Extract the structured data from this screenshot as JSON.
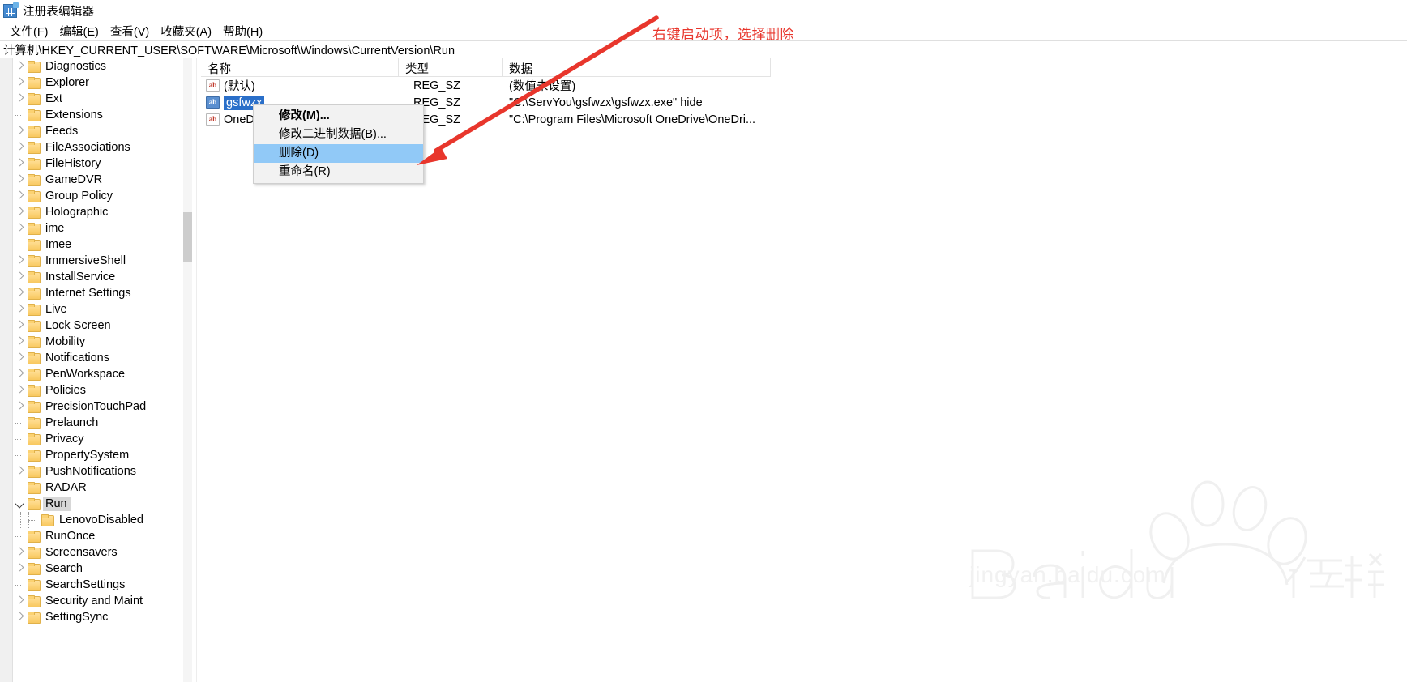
{
  "window": {
    "title": "注册表编辑器",
    "icon": "registry-editor-icon"
  },
  "menubar": {
    "items": [
      {
        "label": "文件(F)",
        "name": "menu-file"
      },
      {
        "label": "编辑(E)",
        "name": "menu-edit"
      },
      {
        "label": "查看(V)",
        "name": "menu-view"
      },
      {
        "label": "收藏夹(A)",
        "name": "menu-favorites"
      },
      {
        "label": "帮助(H)",
        "name": "menu-help"
      }
    ]
  },
  "address": {
    "path": "计算机\\HKEY_CURRENT_USER\\SOFTWARE\\Microsoft\\Windows\\CurrentVersion\\Run"
  },
  "tree": {
    "items": [
      {
        "label": "Diagnostics",
        "state": "collapsed",
        "depth": 1,
        "selected": false
      },
      {
        "label": "Explorer",
        "state": "collapsed",
        "depth": 1,
        "selected": false
      },
      {
        "label": "Ext",
        "state": "collapsed",
        "depth": 1,
        "selected": false
      },
      {
        "label": "Extensions",
        "state": "leaf",
        "depth": 1,
        "selected": false
      },
      {
        "label": "Feeds",
        "state": "collapsed",
        "depth": 1,
        "selected": false
      },
      {
        "label": "FileAssociations",
        "state": "collapsed",
        "depth": 1,
        "selected": false
      },
      {
        "label": "FileHistory",
        "state": "collapsed",
        "depth": 1,
        "selected": false
      },
      {
        "label": "GameDVR",
        "state": "collapsed",
        "depth": 1,
        "selected": false
      },
      {
        "label": "Group Policy",
        "state": "collapsed",
        "depth": 1,
        "selected": false
      },
      {
        "label": "Holographic",
        "state": "collapsed",
        "depth": 1,
        "selected": false
      },
      {
        "label": "ime",
        "state": "collapsed",
        "depth": 1,
        "selected": false
      },
      {
        "label": "Imee",
        "state": "leaf",
        "depth": 1,
        "selected": false
      },
      {
        "label": "ImmersiveShell",
        "state": "collapsed",
        "depth": 1,
        "selected": false
      },
      {
        "label": "InstallService",
        "state": "collapsed",
        "depth": 1,
        "selected": false
      },
      {
        "label": "Internet Settings",
        "state": "collapsed",
        "depth": 1,
        "selected": false
      },
      {
        "label": "Live",
        "state": "collapsed",
        "depth": 1,
        "selected": false
      },
      {
        "label": "Lock Screen",
        "state": "collapsed",
        "depth": 1,
        "selected": false
      },
      {
        "label": "Mobility",
        "state": "collapsed",
        "depth": 1,
        "selected": false
      },
      {
        "label": "Notifications",
        "state": "collapsed",
        "depth": 1,
        "selected": false
      },
      {
        "label": "PenWorkspace",
        "state": "collapsed",
        "depth": 1,
        "selected": false
      },
      {
        "label": "Policies",
        "state": "collapsed",
        "depth": 1,
        "selected": false
      },
      {
        "label": "PrecisionTouchPad",
        "state": "collapsed",
        "depth": 1,
        "selected": false
      },
      {
        "label": "Prelaunch",
        "state": "leaf",
        "depth": 1,
        "selected": false
      },
      {
        "label": "Privacy",
        "state": "leaf",
        "depth": 1,
        "selected": false
      },
      {
        "label": "PropertySystem",
        "state": "leaf",
        "depth": 1,
        "selected": false
      },
      {
        "label": "PushNotifications",
        "state": "collapsed",
        "depth": 1,
        "selected": false
      },
      {
        "label": "RADAR",
        "state": "leaf",
        "depth": 1,
        "selected": false
      },
      {
        "label": "Run",
        "state": "expanded",
        "depth": 1,
        "selected": true
      },
      {
        "label": "LenovoDisabled",
        "state": "leaf",
        "depth": 2,
        "selected": false
      },
      {
        "label": "RunOnce",
        "state": "leaf",
        "depth": 1,
        "selected": false
      },
      {
        "label": "Screensavers",
        "state": "collapsed",
        "depth": 1,
        "selected": false
      },
      {
        "label": "Search",
        "state": "collapsed",
        "depth": 1,
        "selected": false
      },
      {
        "label": "SearchSettings",
        "state": "leaf",
        "depth": 1,
        "selected": false
      },
      {
        "label": "Security and Maint",
        "state": "collapsed",
        "depth": 1,
        "selected": false
      },
      {
        "label": "SettingSync",
        "state": "collapsed",
        "depth": 1,
        "selected": false
      }
    ]
  },
  "list": {
    "columns": [
      {
        "label": "名称",
        "name": "column-name"
      },
      {
        "label": "类型",
        "name": "column-type"
      },
      {
        "label": "数据",
        "name": "column-data"
      }
    ],
    "rows": [
      {
        "name": "(默认)",
        "type": "REG_SZ",
        "data": "(数值未设置)",
        "selected": false,
        "icon": "string-value-icon"
      },
      {
        "name": "gsfwzx",
        "type": "REG_SZ",
        "data": "\"C:\\ServYou\\gsfwzx\\gsfwzx.exe\" hide",
        "selected": true,
        "icon": "string-value-icon"
      },
      {
        "name": "OneDrive",
        "type": "REG_SZ",
        "data": "\"C:\\Program Files\\Microsoft OneDrive\\OneDri...",
        "selected": false,
        "icon": "string-value-icon"
      }
    ]
  },
  "context_menu": {
    "items": [
      {
        "label": "修改(M)...",
        "bold": true,
        "highlighted": false,
        "name": "context-menu-modify"
      },
      {
        "label": "修改二进制数据(B)...",
        "bold": false,
        "highlighted": false,
        "name": "context-menu-modify-binary"
      },
      {
        "label": "删除(D)",
        "bold": false,
        "highlighted": true,
        "name": "context-menu-delete"
      },
      {
        "label": "重命名(R)",
        "bold": false,
        "highlighted": false,
        "name": "context-menu-rename"
      }
    ]
  },
  "annotation": {
    "text": "右键启动项，选择删除",
    "color": "#e8362c"
  },
  "watermark": {
    "brand": "Baidu 经验",
    "url": "jingyan.baidu.com"
  }
}
